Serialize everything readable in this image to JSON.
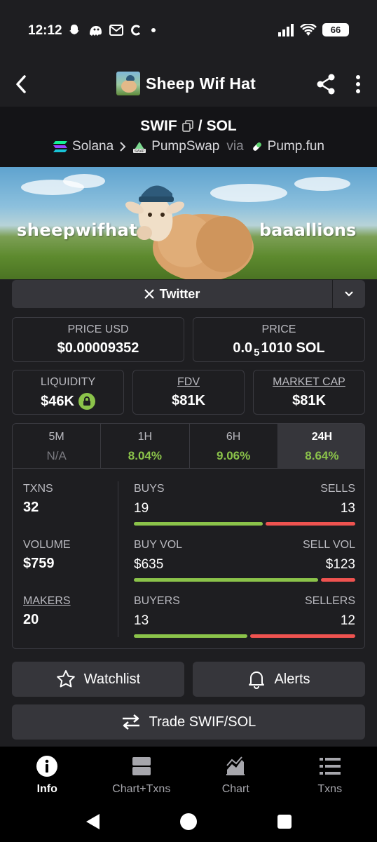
{
  "status_bar": {
    "time": "12:12",
    "battery": "66"
  },
  "header": {
    "title": "Sheep Wif Hat"
  },
  "pair": {
    "base": "SWIF",
    "separator": "/",
    "quote": "SOL"
  },
  "route": {
    "chain": "Solana",
    "dex": "PumpSwap",
    "via": "via",
    "launchpad": "Pump.fun"
  },
  "banner": {
    "left_text": "sheepwifhat",
    "right_text": "baaallions"
  },
  "socials": {
    "twitter_label": "Twitter"
  },
  "prices": {
    "usd_label": "PRICE USD",
    "usd_value": "$0.00009352",
    "native_label": "PRICE",
    "native_prefix": "0.0",
    "native_sub": "5",
    "native_suffix": "1010 SOL"
  },
  "metrics": {
    "liquidity_label": "LIQUIDITY",
    "liquidity_value": "$46K",
    "fdv_label": "FDV",
    "fdv_value": "$81K",
    "mcap_label": "MARKET CAP",
    "mcap_value": "$81K"
  },
  "timeframes": [
    {
      "label": "5M",
      "value": "N/A"
    },
    {
      "label": "1H",
      "value": "8.04%"
    },
    {
      "label": "6H",
      "value": "9.06%"
    },
    {
      "label": "24H",
      "value": "8.64%"
    }
  ],
  "active_timeframe": "24H",
  "stats": {
    "txns_label": "TXNS",
    "txns_value": "32",
    "volume_label": "VOLUME",
    "volume_value": "$759",
    "makers_label": "MAKERS",
    "makers_value": "20",
    "buys_label": "BUYS",
    "buys_value": "19",
    "sells_label": "SELLS",
    "sells_value": "13",
    "buy_vol_label": "BUY VOL",
    "buy_vol_value": "$635",
    "sell_vol_label": "SELL VOL",
    "sell_vol_value": "$123",
    "buyers_label": "BUYERS",
    "buyers_value": "13",
    "sellers_label": "SELLERS",
    "sellers_value": "12",
    "buys_fraction": 0.59,
    "buy_vol_fraction": 0.84,
    "buyers_fraction": 0.52
  },
  "actions": {
    "watchlist": "Watchlist",
    "alerts": "Alerts",
    "trade": "Trade SWIF/SOL"
  },
  "bottom_nav": [
    {
      "label": "Info",
      "icon": "info-icon"
    },
    {
      "label": "Chart+Txns",
      "icon": "split-view-icon"
    },
    {
      "label": "Chart",
      "icon": "area-chart-icon"
    },
    {
      "label": "Txns",
      "icon": "list-icon"
    }
  ],
  "colors": {
    "positive": "#8bc34a",
    "negative": "#ef5350",
    "background": "#1e1e21",
    "surface": "#36363b"
  }
}
